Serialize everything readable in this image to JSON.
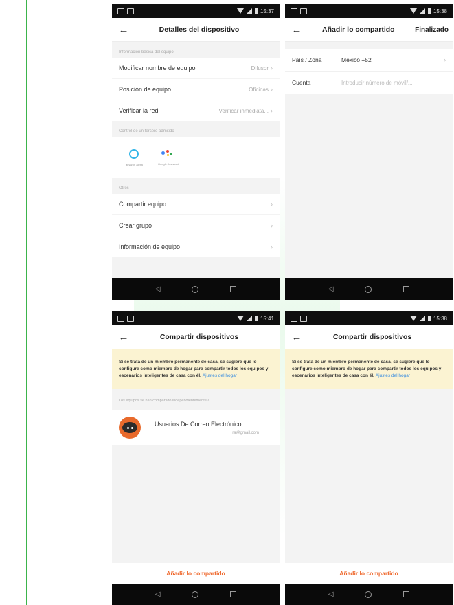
{
  "status": {
    "time1": "15:37",
    "time2": "15:38",
    "time3": "15:41",
    "time4": "15:38"
  },
  "screen1": {
    "title": "Detalles del dispositivo",
    "section_basic": "Información básica del equipo",
    "rows": [
      {
        "label": "Modificar nombre de equipo",
        "value": "Difusor"
      },
      {
        "label": "Posición de equipo",
        "value": "Oficinas"
      },
      {
        "label": "Verificar la red",
        "value": "Verificar inmediata..."
      }
    ],
    "section_assist": "Control de un tercero admitido",
    "assistants": [
      {
        "label": "amazon alexa",
        "icon": "alexa-icon"
      },
      {
        "label": "Google Assistant",
        "icon": "google-assistant-icon"
      }
    ],
    "section_other": "Otros",
    "other_rows": [
      {
        "label": "Compartir equipo"
      },
      {
        "label": "Crear grupo"
      },
      {
        "label": "Información de equipo"
      }
    ]
  },
  "screen2": {
    "title": "Añadir lo compartido",
    "action": "Finalizado",
    "country_label": "País / Zona",
    "country_value": "Mexico +52",
    "account_label": "Cuenta",
    "account_placeholder": "Introducir número de móvil/..."
  },
  "screen3": {
    "title": "Compartir dispositivos",
    "notice": "Si se trata de un miembro permanente de casa, se sugiere que lo configure como miembro de hogar para compartir todos los equipos y escenarios inteligentes de casa con él.",
    "notice_link": "Ajustes del hogar",
    "shared_label": "Los equipos se han compartido independientemente a",
    "contact_name": "Usuarios De Correo Electrónico",
    "contact_email": "ra@gmail.com",
    "button": "Añadir lo compartido"
  },
  "screen4": {
    "title": "Compartir dispositivos",
    "notice": "Si se trata de un miembro permanente de casa, se sugiere que lo configure como miembro de hogar para compartir todos los equipos y escenarios inteligentes de casa con él.",
    "notice_link": "Ajustes del hogar",
    "button": "Añadir lo compartido"
  },
  "icons": {
    "back": "←",
    "chevron": "›",
    "nav_back": "◁"
  },
  "colors": {
    "accent_orange": "#ef6a2f",
    "notice_bg": "#fbf3d2",
    "link_blue": "#3a8de0",
    "margin_green": "#3cb44b"
  }
}
